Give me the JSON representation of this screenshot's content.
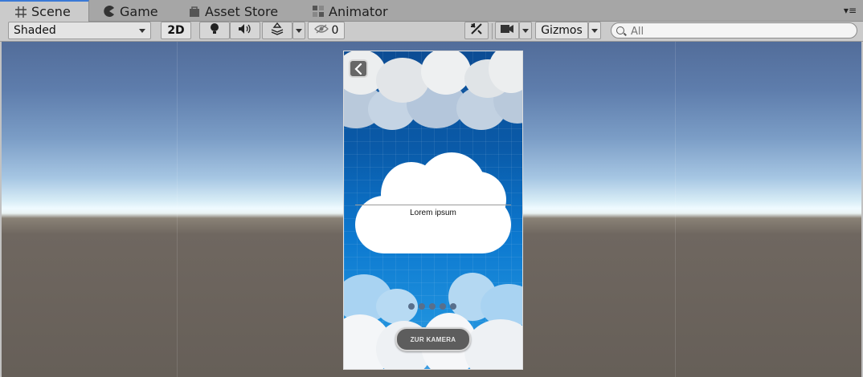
{
  "tabs": [
    {
      "label": "Scene",
      "icon": "grid-icon",
      "active": true
    },
    {
      "label": "Game",
      "icon": "pacman-icon",
      "active": false
    },
    {
      "label": "Asset Store",
      "icon": "store-bag-icon",
      "active": false
    },
    {
      "label": "Animator",
      "icon": "animator-icon",
      "active": false
    }
  ],
  "toolbar": {
    "shading_mode": "Shaded",
    "mode_2d": "2D",
    "hidden_count": "0",
    "gizmos_label": "Gizmos",
    "search_placeholder": "All"
  },
  "viewport": {
    "canvas": {
      "lorem_text": "Lorem ipsum",
      "button_label": "ZUR KAMERA",
      "page_dots": 5
    }
  },
  "colors": {
    "tab_active_accent": "#3a79d6",
    "sky_top": "#526d9a",
    "horizon": "#f0fbff",
    "ground": "#665f58",
    "canvas_sky": "#0a5aa8",
    "button_fill": "#5d5d5d"
  }
}
